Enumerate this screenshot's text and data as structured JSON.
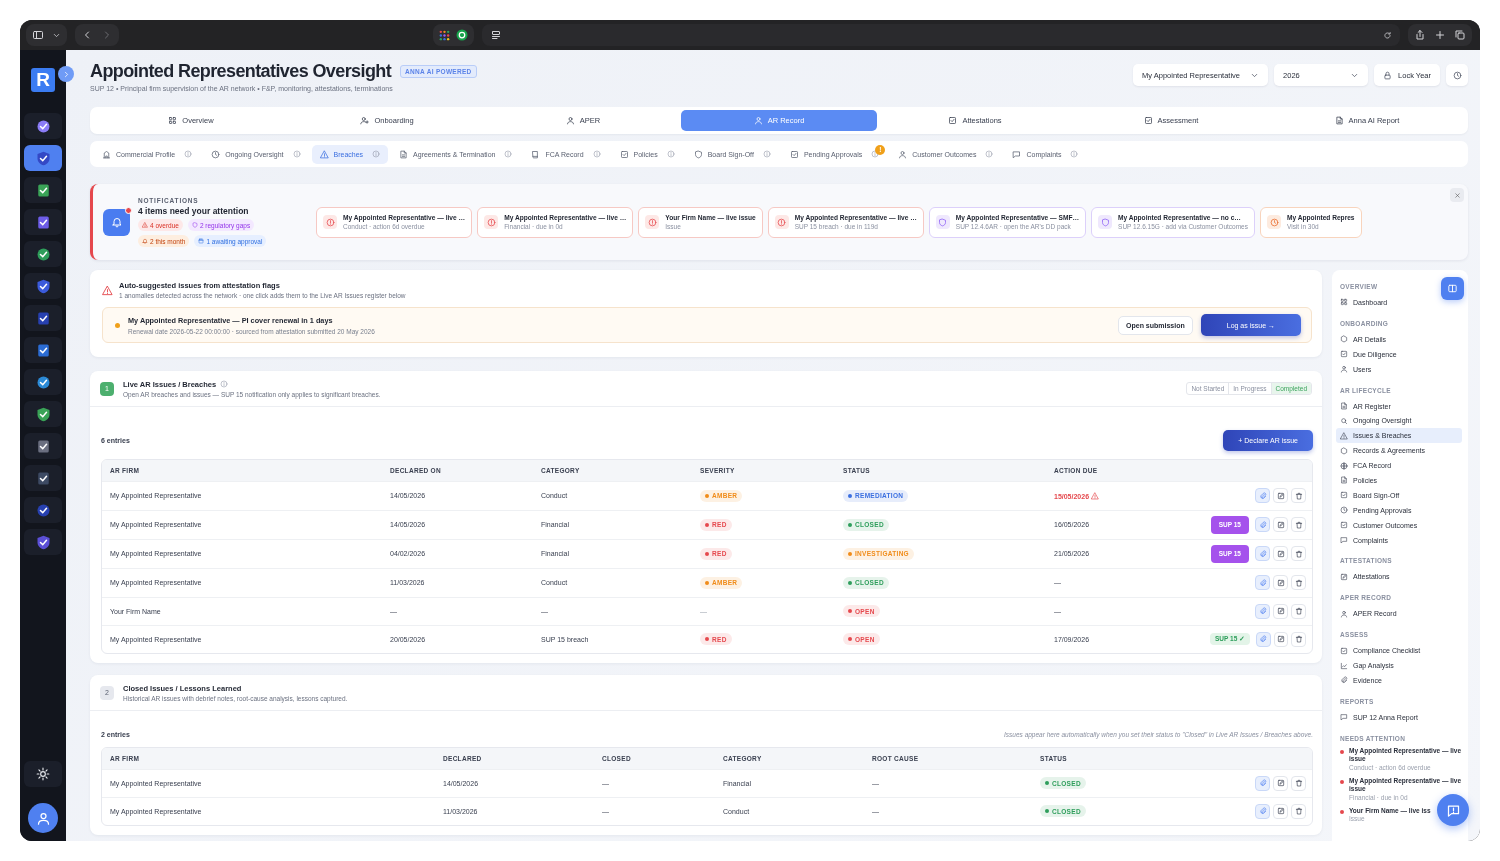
{
  "app_rail": {
    "logo": "R",
    "items": [
      {
        "selected": false
      },
      {
        "selected": true
      },
      {
        "selected": false
      },
      {
        "selected": false
      },
      {
        "selected": false
      },
      {
        "selected": false
      },
      {
        "selected": false
      },
      {
        "selected": false
      },
      {
        "selected": false
      },
      {
        "selected": false
      },
      {
        "selected": false
      },
      {
        "selected": false
      },
      {
        "selected": false
      },
      {
        "selected": false
      }
    ]
  },
  "header": {
    "title": "Appointed Representatives Oversight",
    "badge": "ANNA AI POWERED",
    "subtitle": "SUP 12 • Principal firm supervision of the AR network • F&P, monitoring, attestations, terminations"
  },
  "controls": {
    "representative": "My Appointed Representative",
    "year": "2026",
    "lock_button": "Lock Year"
  },
  "main_tabs": [
    {
      "label": "Overview",
      "selected": false
    },
    {
      "label": "Onboarding",
      "selected": false
    },
    {
      "label": "APER",
      "selected": false
    },
    {
      "label": "AR Record",
      "selected": true
    },
    {
      "label": "Attestations",
      "selected": false
    },
    {
      "label": "Assessment",
      "selected": false
    },
    {
      "label": "Anna AI Report",
      "selected": false
    }
  ],
  "sub_tabs": [
    {
      "label": "Commercial Profile",
      "selected": false
    },
    {
      "label": "Ongoing Oversight",
      "selected": false
    },
    {
      "label": "Breaches",
      "selected": true
    },
    {
      "label": "Agreements & Termination",
      "selected": false
    },
    {
      "label": "FCA Record",
      "selected": false
    },
    {
      "label": "Policies",
      "selected": false
    },
    {
      "label": "Board Sign-Off",
      "selected": false
    },
    {
      "label": "Pending Approvals",
      "selected": false,
      "badge": "!"
    },
    {
      "label": "Customer Outcomes",
      "selected": false
    },
    {
      "label": "Complaints",
      "selected": false
    }
  ],
  "notifications": {
    "heading": "NOTIFICATIONS",
    "title": "4 items need your attention",
    "chips": [
      {
        "label": "4 overdue",
        "kind": "overdue"
      },
      {
        "label": "2 regulatory gaps",
        "kind": "gaps"
      },
      {
        "label": "2 this month",
        "kind": "month"
      },
      {
        "label": "1 awaiting approval",
        "kind": "approval"
      }
    ],
    "cards": [
      {
        "title": "My Appointed Representative — live …",
        "detail": "Conduct · action 6d overdue",
        "kind": "alert"
      },
      {
        "title": "My Appointed Representative — live …",
        "detail": "Financial · due in 0d",
        "kind": "alert"
      },
      {
        "title": "Your Firm Name — live issue",
        "detail": "Issue",
        "kind": "alert"
      },
      {
        "title": "My Appointed Representative — live …",
        "detail": "SUP 15 breach · due in 119d",
        "kind": "alert"
      },
      {
        "title": "My Appointed Representative — SMF…",
        "detail": "SUP 12.4.6AR · open the AR's DD pack",
        "kind": "shield"
      },
      {
        "title": "My Appointed Representative — no c…",
        "detail": "SUP 12.6.15G · add via Customer Outcomes",
        "kind": "shield"
      },
      {
        "title": "My Appointed Repres",
        "detail": "Visit in 30d",
        "kind": "clock"
      }
    ]
  },
  "suggestions": {
    "title": "Auto-suggested issues from attestation flags",
    "subtitle": "1 anomalies detected across the network · one click adds them to the Live AR Issues register below",
    "items": [
      {
        "title": "My Appointed Representative — PI cover renewal in 1 days",
        "detail": "Renewal date 2026-05-22 00:00:00 · sourced from attestation submitted 20 May 2026",
        "open_button": "Open submission",
        "issue_button": "Log as issue →"
      }
    ]
  },
  "live_issues": {
    "number": "1",
    "complete": true,
    "title": "Live AR Issues / Breaches",
    "subtitle": "Open AR breaches and issues — SUP 15 notification only applies to significant breaches.",
    "progress": [
      {
        "label": "Not Started",
        "selected": false
      },
      {
        "label": "In Progress",
        "selected": false
      },
      {
        "label": "Completed",
        "selected": true
      }
    ],
    "entries": "6 entries",
    "declare_button": "+ Declare AR issue",
    "columns": [
      "AR FIRM",
      "DECLARED ON",
      "CATEGORY",
      "SEVERITY",
      "STATUS",
      "ACTION DUE"
    ],
    "rows": [
      {
        "ar_firm": "My Appointed Representative",
        "declared_on": "14/05/2026",
        "category": "Conduct",
        "severity": {
          "label": "AMBER",
          "color": "#f08c1a"
        },
        "status": {
          "label": "REMEDIATION",
          "color": "#3b6fe0"
        },
        "action_due": "15/05/2026",
        "overdue": true
      },
      {
        "ar_firm": "My Appointed Representative",
        "declared_on": "14/05/2026",
        "category": "Financial",
        "severity": {
          "label": "RED",
          "color": "#e5484d"
        },
        "status": {
          "label": "CLOSED",
          "color": "#2e9e5b"
        },
        "action_due": "16/05/2026",
        "overdue": false,
        "sup15": {
          "label": "SUP 15",
          "kind": "pending"
        }
      },
      {
        "ar_firm": "My Appointed Representative",
        "declared_on": "04/02/2026",
        "category": "Financial",
        "severity": {
          "label": "RED",
          "color": "#e5484d"
        },
        "status": {
          "label": "INVESTIGATING",
          "color": "#f08c1a"
        },
        "action_due": "21/05/2026",
        "overdue": false,
        "sup15": {
          "label": "SUP 15",
          "kind": "pending"
        }
      },
      {
        "ar_firm": "My Appointed Representative",
        "declared_on": "11/03/2026",
        "category": "Conduct",
        "severity": {
          "label": "AMBER",
          "color": "#f08c1a"
        },
        "status": {
          "label": "CLOSED",
          "color": "#2e9e5b"
        },
        "action_due": "—",
        "overdue": false
      },
      {
        "ar_firm": "Your Firm Name",
        "declared_on": "—",
        "category": "—",
        "severity": {
          "label": "—"
        },
        "status": {
          "label": "OPEN",
          "color": "#e5484d"
        },
        "action_due": "—",
        "overdue": false
      },
      {
        "ar_firm": "My Appointed Representative",
        "declared_on": "20/05/2026",
        "category": "SUP 15 breach",
        "severity": {
          "label": "RED",
          "color": "#e5484d"
        },
        "status": {
          "label": "OPEN",
          "color": "#e5484d"
        },
        "action_due": "17/09/2026",
        "overdue": false,
        "sup15": {
          "label": "SUP 15 ✓",
          "kind": "done"
        }
      }
    ]
  },
  "closed_issues": {
    "number": "2",
    "complete": false,
    "title": "Closed Issues / Lessons Learned",
    "subtitle": "Historical AR issues with debrief notes, root-cause analysis, lessons captured.",
    "entries": "2 entries",
    "note": "Issues appear here automatically when you set their status to \"Closed\" in Live AR Issues / Breaches above.",
    "columns": [
      "AR FIRM",
      "DECLARED",
      "CLOSED",
      "CATEGORY",
      "ROOT CAUSE",
      "STATUS"
    ],
    "rows": [
      {
        "ar_firm": "My Appointed Representative",
        "declared": "14/05/2026",
        "closed": "—",
        "category": "Financial",
        "root_cause": "—",
        "status": {
          "label": "CLOSED",
          "color": "#2e9e5b"
        }
      },
      {
        "ar_firm": "My Appointed Representative",
        "declared": "11/03/2026",
        "closed": "—",
        "category": "Conduct",
        "root_cause": "—",
        "status": {
          "label": "CLOSED",
          "color": "#2e9e5b"
        }
      }
    ]
  },
  "side_nav": {
    "sections": [
      {
        "heading": "OVERVIEW",
        "items": [
          {
            "label": "Dashboard",
            "selected": false
          }
        ]
      },
      {
        "heading": "ONBOARDING",
        "items": [
          {
            "label": "AR Details",
            "selected": false
          },
          {
            "label": "Due Diligence",
            "selected": false
          },
          {
            "label": "Users",
            "selected": false
          }
        ]
      },
      {
        "heading": "AR LIFECYCLE",
        "items": [
          {
            "label": "AR Register",
            "selected": false
          },
          {
            "label": "Ongoing Oversight",
            "selected": false
          },
          {
            "label": "Issues & Breaches",
            "selected": true
          },
          {
            "label": "Records & Agreements",
            "selected": false
          },
          {
            "label": "FCA Record",
            "selected": false
          },
          {
            "label": "Policies",
            "selected": false
          },
          {
            "label": "Board Sign-Off",
            "selected": false
          },
          {
            "label": "Pending Approvals",
            "selected": false
          },
          {
            "label": "Customer Outcomes",
            "selected": false
          },
          {
            "label": "Complaints",
            "selected": false
          }
        ]
      },
      {
        "heading": "ATTESTATIONS",
        "items": [
          {
            "label": "Attestations",
            "selected": false
          }
        ]
      },
      {
        "heading": "APER RECORD",
        "items": [
          {
            "label": "APER Record",
            "selected": false
          }
        ]
      },
      {
        "heading": "ASSESS",
        "items": [
          {
            "label": "Compliance Checklist",
            "selected": false
          },
          {
            "label": "Gap Analysis",
            "selected": false
          },
          {
            "label": "Evidence",
            "selected": false
          }
        ]
      },
      {
        "heading": "REPORTS",
        "items": [
          {
            "label": "SUP 12 Anna Report",
            "selected": false
          }
        ]
      }
    ],
    "attention": {
      "heading": "NEEDS ATTENTION",
      "items": [
        {
          "title": "My Appointed Representative — live issue",
          "detail": "Conduct · action 6d overdue"
        },
        {
          "title": "My Appointed Representative — live issue",
          "detail": "Financial · due in 0d"
        },
        {
          "title": "Your Firm Name — live iss",
          "detail": "Issue"
        }
      ]
    }
  }
}
